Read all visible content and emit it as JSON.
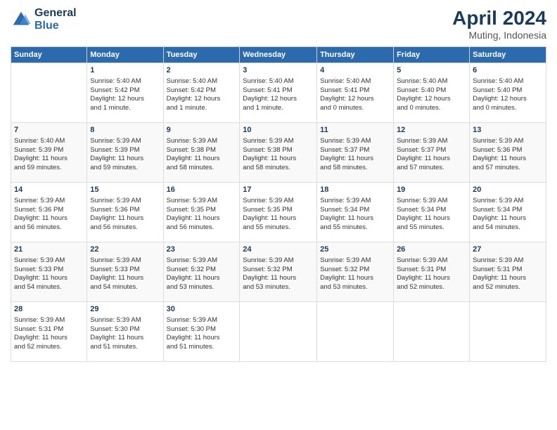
{
  "header": {
    "logo_line1": "General",
    "logo_line2": "Blue",
    "month_year": "April 2024",
    "location": "Muting, Indonesia"
  },
  "columns": [
    "Sunday",
    "Monday",
    "Tuesday",
    "Wednesday",
    "Thursday",
    "Friday",
    "Saturday"
  ],
  "weeks": [
    [
      {
        "day": "",
        "info": ""
      },
      {
        "day": "1",
        "info": "Sunrise: 5:40 AM\nSunset: 5:42 PM\nDaylight: 12 hours\nand 1 minute."
      },
      {
        "day": "2",
        "info": "Sunrise: 5:40 AM\nSunset: 5:42 PM\nDaylight: 12 hours\nand 1 minute."
      },
      {
        "day": "3",
        "info": "Sunrise: 5:40 AM\nSunset: 5:41 PM\nDaylight: 12 hours\nand 1 minute."
      },
      {
        "day": "4",
        "info": "Sunrise: 5:40 AM\nSunset: 5:41 PM\nDaylight: 12 hours\nand 0 minutes."
      },
      {
        "day": "5",
        "info": "Sunrise: 5:40 AM\nSunset: 5:40 PM\nDaylight: 12 hours\nand 0 minutes."
      },
      {
        "day": "6",
        "info": "Sunrise: 5:40 AM\nSunset: 5:40 PM\nDaylight: 12 hours\nand 0 minutes."
      }
    ],
    [
      {
        "day": "7",
        "info": "Sunrise: 5:40 AM\nSunset: 5:39 PM\nDaylight: 11 hours\nand 59 minutes."
      },
      {
        "day": "8",
        "info": "Sunrise: 5:39 AM\nSunset: 5:39 PM\nDaylight: 11 hours\nand 59 minutes."
      },
      {
        "day": "9",
        "info": "Sunrise: 5:39 AM\nSunset: 5:38 PM\nDaylight: 11 hours\nand 58 minutes."
      },
      {
        "day": "10",
        "info": "Sunrise: 5:39 AM\nSunset: 5:38 PM\nDaylight: 11 hours\nand 58 minutes."
      },
      {
        "day": "11",
        "info": "Sunrise: 5:39 AM\nSunset: 5:37 PM\nDaylight: 11 hours\nand 58 minutes."
      },
      {
        "day": "12",
        "info": "Sunrise: 5:39 AM\nSunset: 5:37 PM\nDaylight: 11 hours\nand 57 minutes."
      },
      {
        "day": "13",
        "info": "Sunrise: 5:39 AM\nSunset: 5:36 PM\nDaylight: 11 hours\nand 57 minutes."
      }
    ],
    [
      {
        "day": "14",
        "info": "Sunrise: 5:39 AM\nSunset: 5:36 PM\nDaylight: 11 hours\nand 56 minutes."
      },
      {
        "day": "15",
        "info": "Sunrise: 5:39 AM\nSunset: 5:36 PM\nDaylight: 11 hours\nand 56 minutes."
      },
      {
        "day": "16",
        "info": "Sunrise: 5:39 AM\nSunset: 5:35 PM\nDaylight: 11 hours\nand 56 minutes."
      },
      {
        "day": "17",
        "info": "Sunrise: 5:39 AM\nSunset: 5:35 PM\nDaylight: 11 hours\nand 55 minutes."
      },
      {
        "day": "18",
        "info": "Sunrise: 5:39 AM\nSunset: 5:34 PM\nDaylight: 11 hours\nand 55 minutes."
      },
      {
        "day": "19",
        "info": "Sunrise: 5:39 AM\nSunset: 5:34 PM\nDaylight: 11 hours\nand 55 minutes."
      },
      {
        "day": "20",
        "info": "Sunrise: 5:39 AM\nSunset: 5:34 PM\nDaylight: 11 hours\nand 54 minutes."
      }
    ],
    [
      {
        "day": "21",
        "info": "Sunrise: 5:39 AM\nSunset: 5:33 PM\nDaylight: 11 hours\nand 54 minutes."
      },
      {
        "day": "22",
        "info": "Sunrise: 5:39 AM\nSunset: 5:33 PM\nDaylight: 11 hours\nand 54 minutes."
      },
      {
        "day": "23",
        "info": "Sunrise: 5:39 AM\nSunset: 5:32 PM\nDaylight: 11 hours\nand 53 minutes."
      },
      {
        "day": "24",
        "info": "Sunrise: 5:39 AM\nSunset: 5:32 PM\nDaylight: 11 hours\nand 53 minutes."
      },
      {
        "day": "25",
        "info": "Sunrise: 5:39 AM\nSunset: 5:32 PM\nDaylight: 11 hours\nand 53 minutes."
      },
      {
        "day": "26",
        "info": "Sunrise: 5:39 AM\nSunset: 5:31 PM\nDaylight: 11 hours\nand 52 minutes."
      },
      {
        "day": "27",
        "info": "Sunrise: 5:39 AM\nSunset: 5:31 PM\nDaylight: 11 hours\nand 52 minutes."
      }
    ],
    [
      {
        "day": "28",
        "info": "Sunrise: 5:39 AM\nSunset: 5:31 PM\nDaylight: 11 hours\nand 52 minutes."
      },
      {
        "day": "29",
        "info": "Sunrise: 5:39 AM\nSunset: 5:30 PM\nDaylight: 11 hours\nand 51 minutes."
      },
      {
        "day": "30",
        "info": "Sunrise: 5:39 AM\nSunset: 5:30 PM\nDaylight: 11 hours\nand 51 minutes."
      },
      {
        "day": "",
        "info": ""
      },
      {
        "day": "",
        "info": ""
      },
      {
        "day": "",
        "info": ""
      },
      {
        "day": "",
        "info": ""
      }
    ]
  ]
}
